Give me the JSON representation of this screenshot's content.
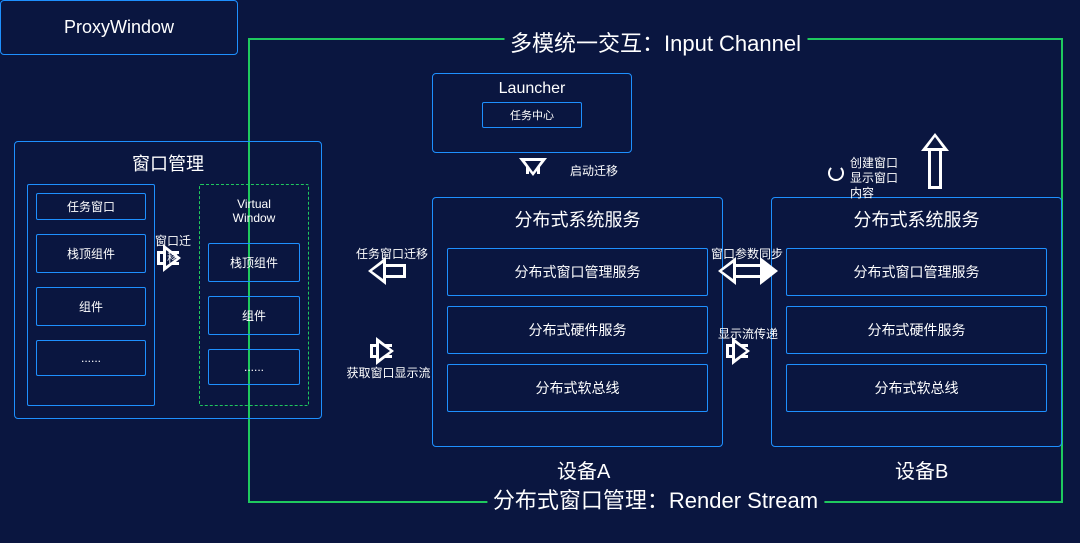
{
  "frame": {
    "top_title": "多模统一交互：Input Channel",
    "bottom_title": "分布式窗口管理：Render Stream"
  },
  "wm": {
    "title": "窗口管理",
    "task_window": "任务窗口",
    "virtual_window": "Virtual\nWindow",
    "top_comp": "栈顶组件",
    "comp": "组件",
    "dots": "......",
    "arrow_label": "窗口迁移"
  },
  "launcher": {
    "title": "Launcher",
    "task_center": "任务中心",
    "arrow_label": "启动迁移"
  },
  "dssA": {
    "title": "分布式系统服务",
    "row1": "分布式窗口管理服务",
    "row2": "分布式硬件服务",
    "row3": "分布式软总线",
    "device": "设备A"
  },
  "dssB": {
    "title": "分布式系统服务",
    "row1": "分布式窗口管理服务",
    "row2": "分布式硬件服务",
    "row3": "分布式软总线",
    "device": "设备B"
  },
  "proxy": {
    "title": "ProxyWindow",
    "note": "创建窗口\n显示窗口\n内容"
  },
  "arrows": {
    "task_window_migrate": "任务窗口迁移",
    "get_render_stream": "获取窗口显示流",
    "window_param_sync": "窗口参数同步",
    "render_stream_pass": "显示流传递"
  }
}
